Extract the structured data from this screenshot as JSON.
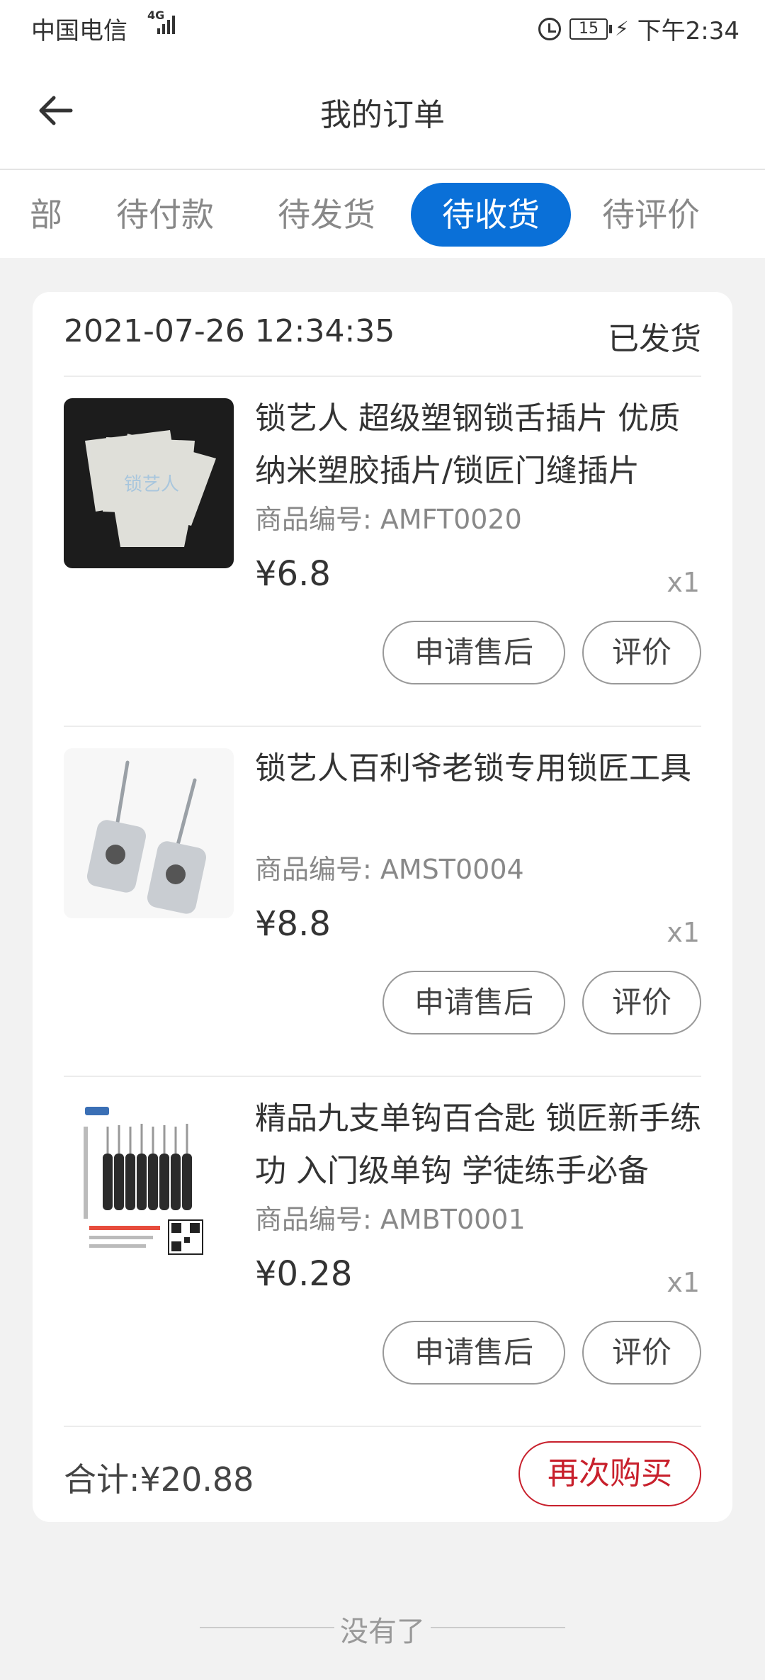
{
  "status_bar": {
    "carrier": "中国电信",
    "network": "4G",
    "battery": "15",
    "time": "下午2:34"
  },
  "header": {
    "title": "我的订单"
  },
  "tabs": [
    {
      "label": "部"
    },
    {
      "label": "待付款"
    },
    {
      "label": "待发货"
    },
    {
      "label": "待收货",
      "active": true
    },
    {
      "label": "待评价"
    }
  ],
  "order": {
    "date": "2021-07-26 12:34:35",
    "status": "已发货",
    "items": [
      {
        "name": "锁艺人 超级塑钢锁舌插片 优质纳米塑胶插片/锁匠门缝插片",
        "code": "商品编号: AMFT0020",
        "price": "¥6.8",
        "qty": "x1",
        "image_icon": "plastic-shims-image"
      },
      {
        "name": "锁艺人百利爷老锁专用锁匠工具",
        "code": "商品编号: AMST0004",
        "price": "¥8.8",
        "qty": "x1",
        "image_icon": "lock-picks-image"
      },
      {
        "name": "精品九支单钩百合匙 锁匠新手练功 入门级单钩 学徒练手必备",
        "code": "商品编号: AMBT0001",
        "price": "¥0.28",
        "qty": "x1",
        "image_icon": "pick-set-image"
      }
    ],
    "after_sale_label": "申请售后",
    "review_label": "评价",
    "total": "合计:¥20.88",
    "rebuy_label": "再次购买"
  },
  "footer": {
    "end_text": "没有了"
  },
  "colors": {
    "accent": "#0a70d8",
    "rebuy": "#c8202c"
  }
}
